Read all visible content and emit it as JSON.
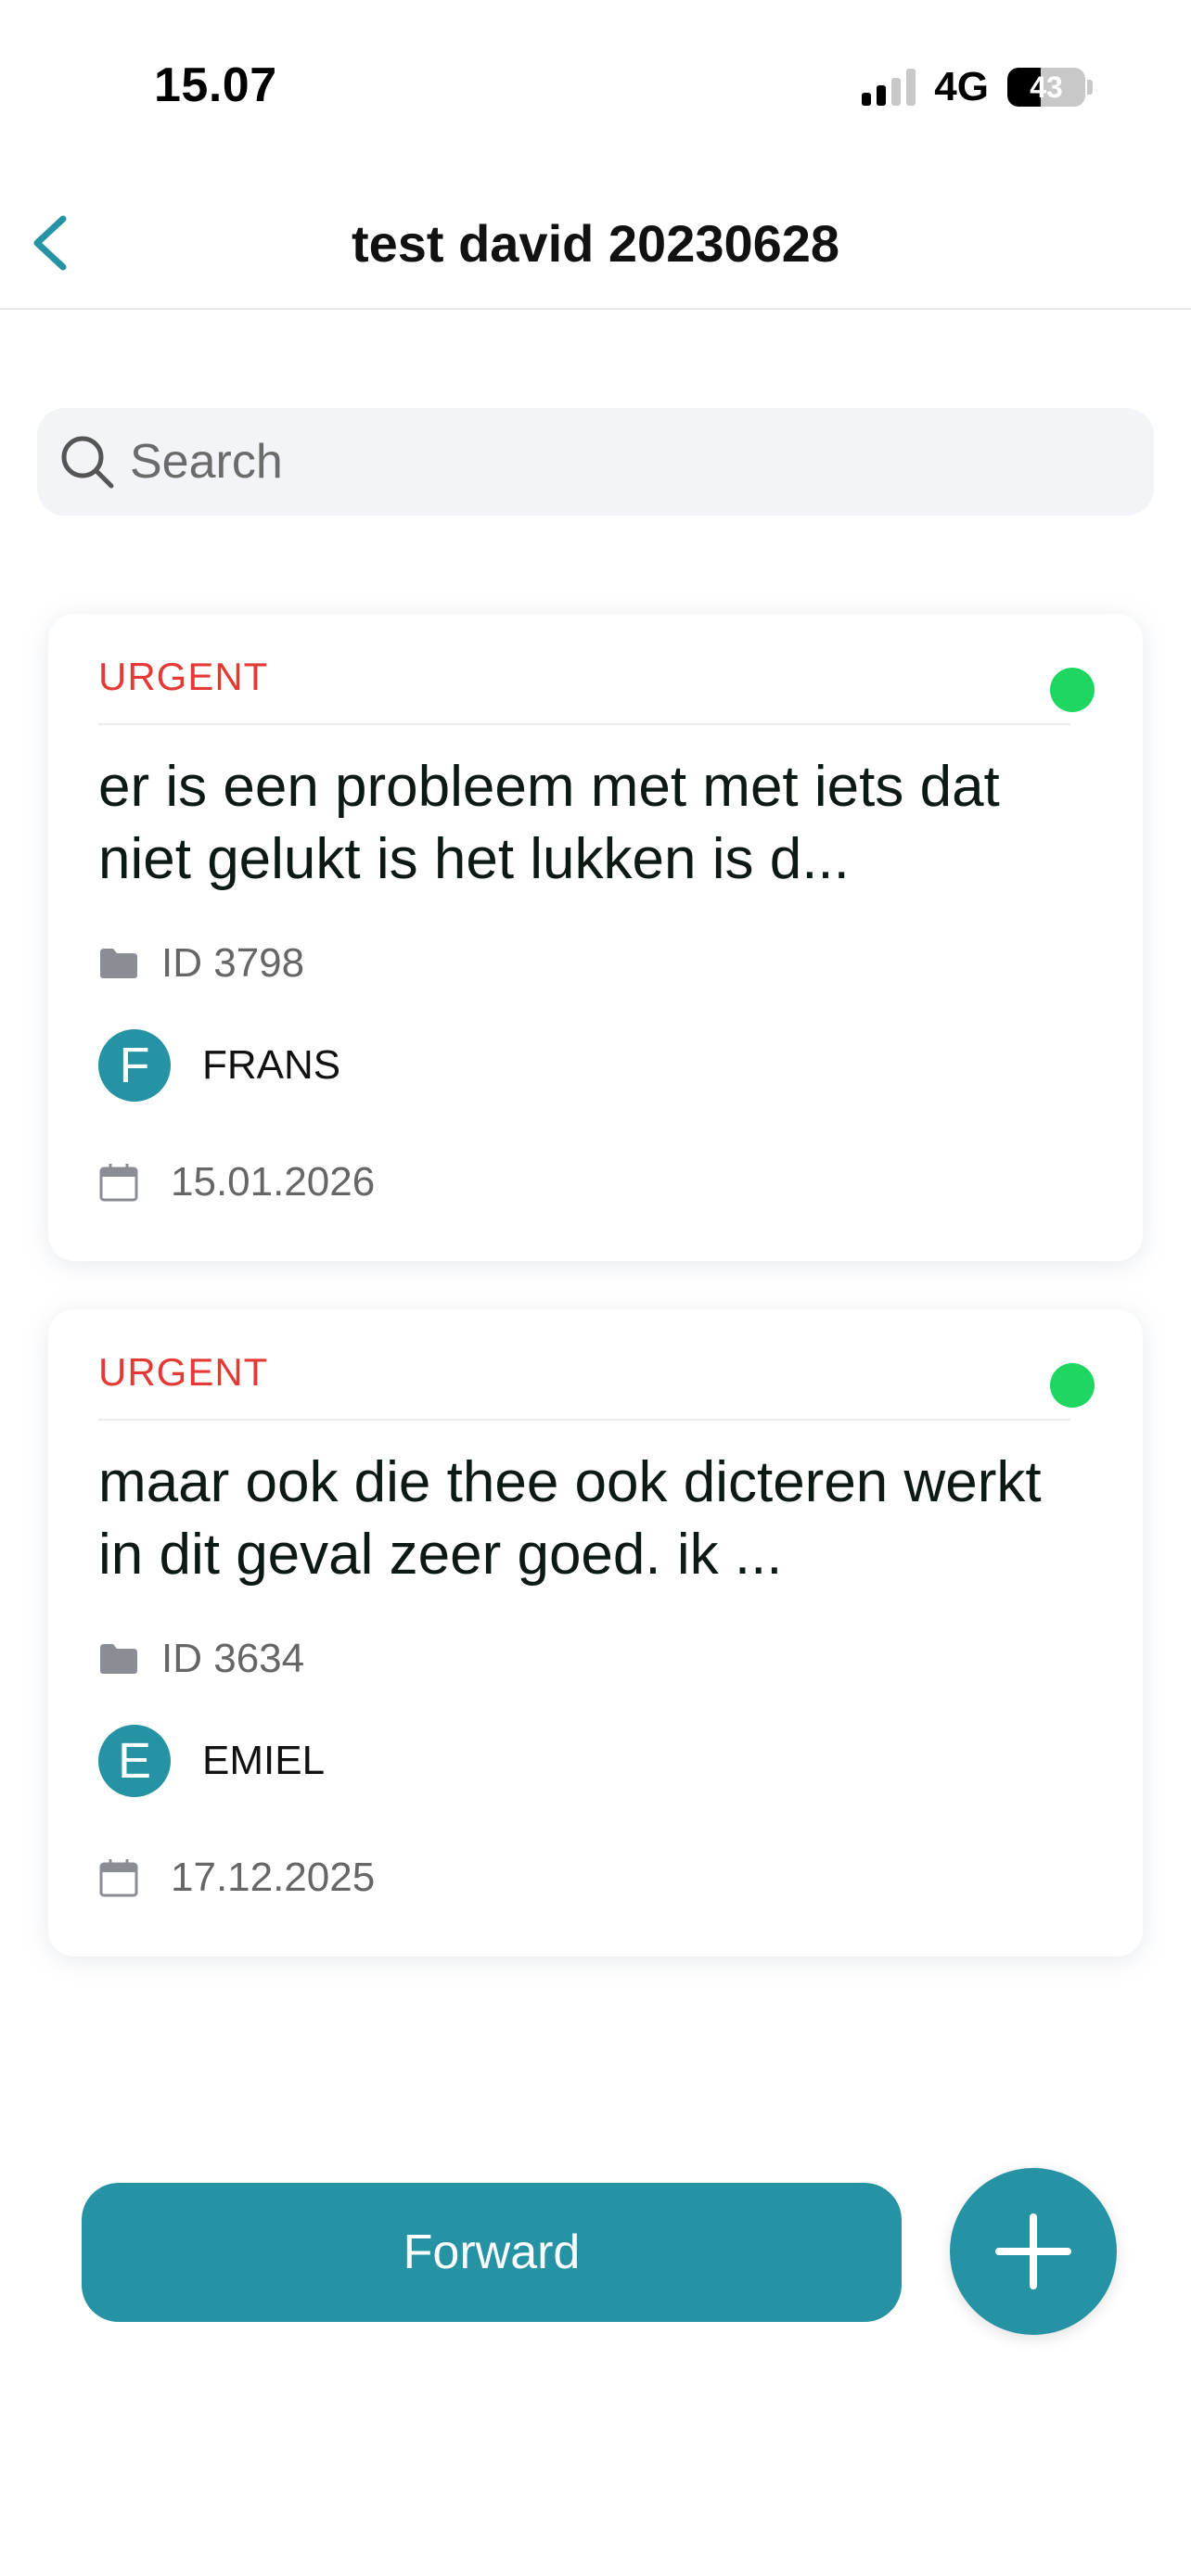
{
  "status_bar": {
    "time": "15.07",
    "network": "4G",
    "battery": "43",
    "battery_level": 0.43
  },
  "header": {
    "title": "test david 20230628",
    "back_icon": "chevron-left-icon"
  },
  "search": {
    "placeholder": "Search",
    "value": "",
    "icon": "search-icon"
  },
  "tickets": [
    {
      "priority": "URGENT",
      "title": "er is een probleem met met iets dat niet gelukt is het lukken is d...",
      "id_label": "ID 3798",
      "user_initial": "F",
      "user_name": "FRANS",
      "date": "15.01.2026",
      "status_color": "#1ed760"
    },
    {
      "priority": "URGENT",
      "title": "maar ook die thee ook dicteren werkt in dit geval zeer goed. ik ...",
      "id_label": "ID 3634",
      "user_initial": "E",
      "user_name": "EMIEL",
      "date": "17.12.2025",
      "status_color": "#1ed760"
    }
  ],
  "actions": {
    "forward_label": "Forward",
    "add_icon": "plus-icon"
  },
  "colors": {
    "accent": "#2593a3",
    "urgent": "#e53935",
    "status_online": "#1ed760"
  }
}
